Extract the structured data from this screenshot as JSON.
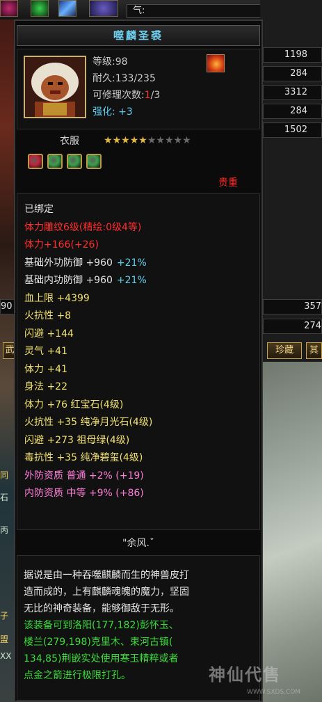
{
  "top_bar": {
    "qi_label": "气:"
  },
  "right_stats": [
    "1198",
    "284",
    "3312",
    "284",
    "1502",
    "357",
    "274"
  ],
  "left_stat": "90",
  "tabs": {
    "collection": "珍藏",
    "partial_left": "武",
    "partial_right": "其"
  },
  "left_edge_texts": [
    "同",
    "石",
    "丙",
    "子",
    "盟",
    "XX"
  ],
  "item": {
    "name": "噬麟圣裘",
    "level": "等级:98",
    "durability": "耐久:133/235",
    "repair_prefix": "可修理次数:",
    "repair_used": "1",
    "repair_total": "/3",
    "enhance": "强化: +3",
    "slot": "衣服",
    "stars_total": 10,
    "stars_filled": 5,
    "quality": "贵重",
    "gem_slot_colors": [
      "#c0243a",
      "#3aa04a",
      "#3aa04a",
      "#3aa04a"
    ]
  },
  "attributes": [
    {
      "text": "已绑定",
      "color": "white"
    },
    {
      "text": "体力雕纹6级(精绘:0级4等)",
      "color": "red"
    },
    {
      "text": "体力+166(+26)",
      "color": "red"
    },
    {
      "text": "基础外功防御 +960",
      "extra": "+21%",
      "color": "white"
    },
    {
      "text": "基础内功防御 +960",
      "extra": "+21%",
      "color": "white"
    },
    {
      "text": "血上限 +4399",
      "color": "yellow"
    },
    {
      "text": "火抗性 +8",
      "color": "yellow"
    },
    {
      "text": "闪避 +144",
      "color": "yellow"
    },
    {
      "text": "灵气 +41",
      "color": "yellow"
    },
    {
      "text": "体力 +41",
      "color": "yellow"
    },
    {
      "text": "身法 +22",
      "color": "yellow"
    },
    {
      "text": "体力 +76 红宝石(4级)",
      "color": "yellow"
    },
    {
      "text": "火抗性 +35 纯净月光石(4级)",
      "color": "yellow"
    },
    {
      "text": "闪避 +273 祖母绿(4级)",
      "color": "yellow"
    },
    {
      "text": "毒抗性 +35 纯净碧玺(4级)",
      "color": "yellow"
    },
    {
      "text": "外防资质  普通 +2% (+19)",
      "color": "pink"
    },
    {
      "text": "内防资质  中等 +9% (+86)",
      "color": "pink"
    }
  ],
  "owner": "\"余风.ˇ",
  "description": [
    {
      "text": "据说是由一种吞噬麒麟而生的神兽皮打",
      "color": "white"
    },
    {
      "text": "造而成的，上有麒麟魂魄的魔力，坚固",
      "color": "white"
    },
    {
      "text": "无比的神奇装备，能够御敌于无形。",
      "color": "white"
    },
    {
      "text": "该装备可到洛阳(177,182)彭怀玉、",
      "color": "green"
    },
    {
      "text": "楼兰(279,198)克里木、束河古镇(",
      "color": "green"
    },
    {
      "text": "134,85)荆嵌实处使用寒玉精粹或者",
      "color": "green"
    },
    {
      "text": "点金之箭进行极限打孔。",
      "color": "green"
    }
  ],
  "watermark": {
    "text": "神仙代售",
    "url": "WWW.SXDS.COM"
  }
}
